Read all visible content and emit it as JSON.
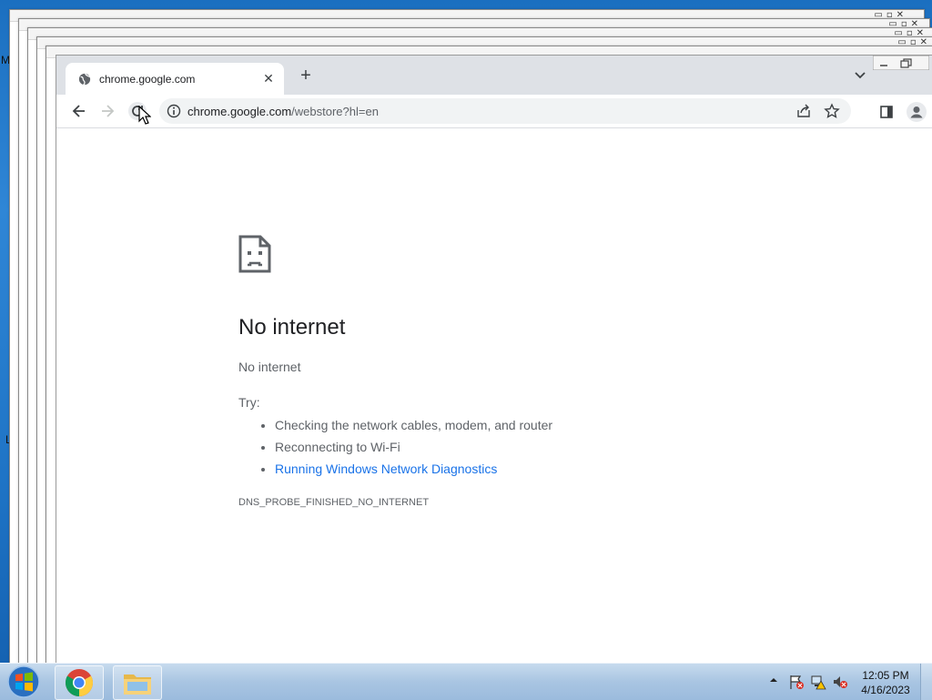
{
  "desktop": {
    "edge_letters": [
      "M",
      "L"
    ]
  },
  "browser": {
    "tab": {
      "title": "chrome.google.com",
      "close_glyph": "✕"
    },
    "new_tab_glyph": "+",
    "address_bar": {
      "host": "chrome.google.com",
      "path": "/webstore?hl=en"
    },
    "icons": {
      "back": "back-arrow-icon",
      "forward": "forward-arrow-icon",
      "reload": "reload-icon",
      "info": "info-icon",
      "share": "share-icon",
      "bookmark": "star-icon",
      "side_panel": "side-panel-icon",
      "profile": "profile-icon"
    }
  },
  "error_page": {
    "title": "No internet",
    "subtitle": "No internet",
    "try_label": "Try:",
    "suggestions": [
      "Checking the network cables, modem, and router",
      "Reconnecting to Wi-Fi"
    ],
    "diagnostics_link": "Running Windows Network Diagnostics",
    "error_code": "DNS_PROBE_FINISHED_NO_INTERNET"
  },
  "taskbar": {
    "clock_time": "12:05 PM",
    "clock_date": "4/16/2023",
    "pinned": [
      "chrome-icon",
      "file-explorer-icon"
    ]
  },
  "colors": {
    "link": "#1a73e8",
    "tab_strip": "#dee1e6",
    "omnibox": "#f1f3f4"
  }
}
